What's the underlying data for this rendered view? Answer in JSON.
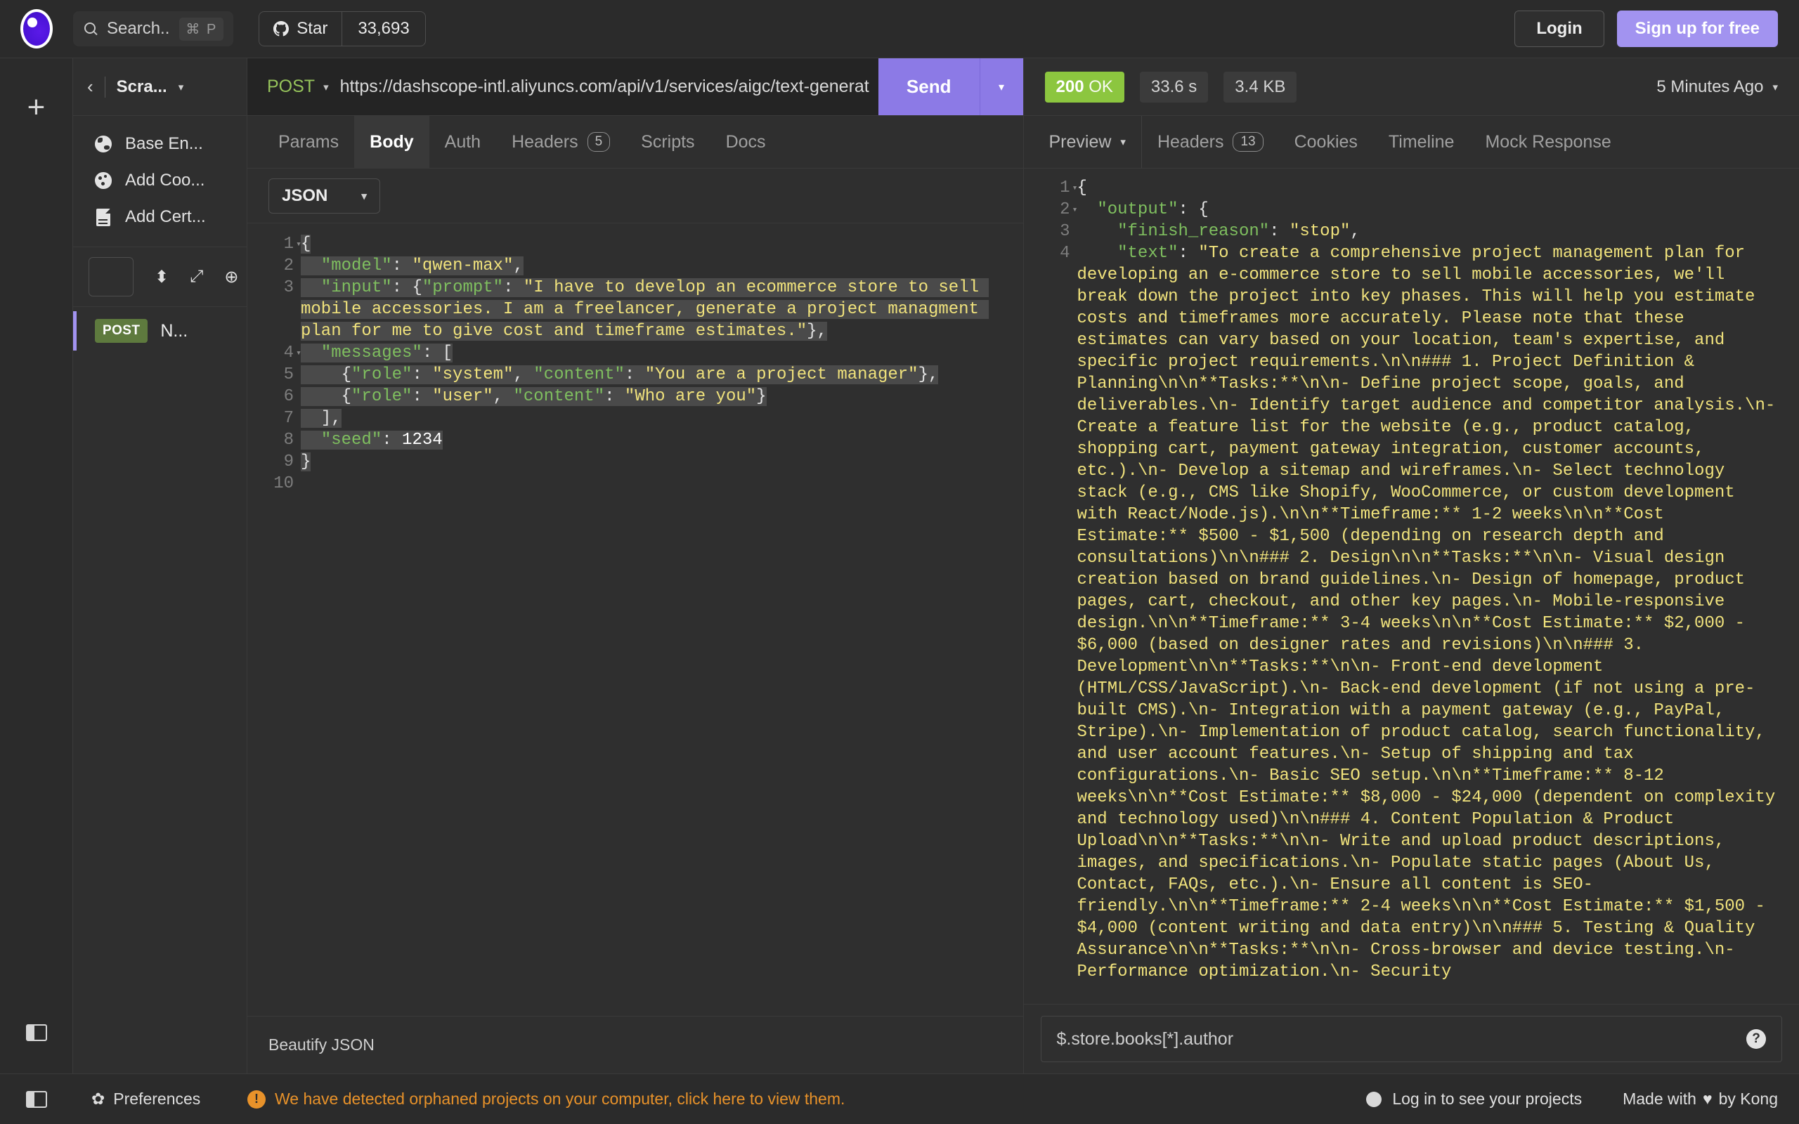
{
  "topbar": {
    "logo_icon": "insomnia-logo-icon",
    "search_placeholder": "Search..",
    "search_shortcut": "⌘ P",
    "star_label": "Star",
    "star_count": "33,693",
    "github_icon": "github-icon",
    "login_label": "Login",
    "signup_label": "Sign up for free"
  },
  "rail": {
    "add_icon": "plus-icon",
    "panel_toggle_icon": "sidebar-toggle-icon"
  },
  "sidebar": {
    "back_icon": "chevron-left-icon",
    "workspace_name": "Scra...",
    "workspace_caret": "▾",
    "actions": [
      {
        "label": "Base En...",
        "icon": "globe-icon"
      },
      {
        "label": "Add Coo...",
        "icon": "cookie-icon"
      },
      {
        "label": "Add Cert...",
        "icon": "certificate-icon"
      }
    ],
    "tools": {
      "filter_icon": "filter-box-icon",
      "sort_icon": "sort-updown-icon",
      "expand_icon": "expand-arrows-icon",
      "add_icon": "plus-circle-icon"
    },
    "requests": [
      {
        "method": "POST",
        "name": "N...",
        "active": true
      }
    ]
  },
  "request": {
    "method": "POST",
    "method_caret": "▾",
    "url": "https://dashscope-intl.aliyuncs.com/api/v1/services/aigc/text-generat",
    "send_label": "Send",
    "send_caret": "▾",
    "tabs": [
      {
        "label": "Params",
        "active": false
      },
      {
        "label": "Body",
        "active": true
      },
      {
        "label": "Auth",
        "active": false
      },
      {
        "label": "Headers",
        "active": false,
        "badge": "5"
      },
      {
        "label": "Scripts",
        "active": false
      },
      {
        "label": "Docs",
        "active": false
      }
    ],
    "body_type": "JSON",
    "body_type_caret": "▾",
    "beautify_label": "Beautify JSON",
    "editor": {
      "line_numbers": [
        "1",
        "2",
        "3",
        "4",
        "5",
        "6",
        "7",
        "8",
        "9",
        "10"
      ],
      "fold_lines": [
        "1",
        "4"
      ],
      "lines": [
        "{",
        "  \"model\": \"qwen-max\",",
        "  \"input\": {\"prompt\": \"I have to develop an ecommerce store to sell mobile accessories. I am a freelancer, generate a project managment plan for me to give cost and timeframe estimates.\"},",
        "  \"messages\": [",
        "    {\"role\": \"system\", \"content\": \"You are a project manager\"},",
        "    {\"role\": \"user\", \"content\": \"Who are you\"}",
        "  ],",
        "  \"seed\": 1234",
        "}",
        ""
      ]
    }
  },
  "response": {
    "status_code": "200",
    "status_text": "OK",
    "elapsed": "33.6 s",
    "size": "3.4 KB",
    "history_label": "5 Minutes Ago",
    "history_caret": "▾",
    "tabs": [
      {
        "label": "Preview",
        "caret": "▾",
        "active": true
      },
      {
        "label": "Headers",
        "badge": "13",
        "active": false
      },
      {
        "label": "Cookies",
        "active": false
      },
      {
        "label": "Timeline",
        "active": false
      },
      {
        "label": "Mock Response",
        "active": false
      }
    ],
    "filter_value": "$.store.books[*].author",
    "help_icon": "question-mark-icon",
    "editor": {
      "line_numbers": [
        "1",
        "2",
        "3",
        "4"
      ],
      "fold_lines": [
        "1",
        "2"
      ],
      "json_open": "{",
      "output_key": "\"output\"",
      "output_open": ": {",
      "finish_reason_key": "\"finish_reason\"",
      "finish_reason_value": "\"stop\",",
      "text_key": "\"text\"",
      "text_value": "\"To create a comprehensive project management plan for developing an e-commerce store to sell mobile accessories, we'll break down the project into key phases. This will help you estimate costs and timeframes more accurately. Please note that these estimates can vary based on your location, team's expertise, and specific project requirements.\\n\\n### 1. Project Definition & Planning\\n\\n**Tasks:**\\n\\n- Define project scope, goals, and deliverables.\\n- Identify target audience and competitor analysis.\\n- Create a feature list for the website (e.g., product catalog, shopping cart, payment gateway integration, customer accounts, etc.).\\n- Develop a sitemap and wireframes.\\n- Select technology stack (e.g., CMS like Shopify, WooCommerce, or custom development with React/Node.js).\\n\\n**Timeframe:** 1-2 weeks\\n\\n**Cost Estimate:** $500 - $1,500 (depending on research depth and consultations)\\n\\n### 2. Design\\n\\n**Tasks:**\\n\\n- Visual design creation based on brand guidelines.\\n- Design of homepage, product pages, cart, checkout, and other key pages.\\n- Mobile-responsive design.\\n\\n**Timeframe:** 3-4 weeks\\n\\n**Cost Estimate:** $2,000 - $6,000 (based on designer rates and revisions)\\n\\n### 3. Development\\n\\n**Tasks:**\\n\\n- Front-end development (HTML/CSS/JavaScript).\\n- Back-end development (if not using a pre-built CMS).\\n- Integration with a payment gateway (e.g., PayPal, Stripe).\\n- Implementation of product catalog, search functionality, and user account features.\\n- Setup of shipping and tax configurations.\\n- Basic SEO setup.\\n\\n**Timeframe:** 8-12 weeks\\n\\n**Cost Estimate:** $8,000 - $24,000 (dependent on complexity and technology used)\\n\\n### 4. Content Population & Product Upload\\n\\n**Tasks:**\\n\\n- Write and upload product descriptions, images, and specifications.\\n- Populate static pages (About Us, Contact, FAQs, etc.).\\n- Ensure all content is SEO-friendly.\\n\\n**Timeframe:** 2-4 weeks\\n\\n**Cost Estimate:** $1,500 - $4,000 (content writing and data entry)\\n\\n### 5. Testing & Quality Assurance\\n\\n**Tasks:**\\n\\n- Cross-browser and device testing.\\n- Performance optimization.\\n- Security"
    }
  },
  "statusbar": {
    "preferences_label": "Preferences",
    "gear_icon": "gear-icon",
    "warning_icon": "warning-icon",
    "warning_text": "We have detected orphaned projects on your computer, click here to view them.",
    "login_projects_label": "Log in to see your projects",
    "status_dot_icon": "status-dot-icon",
    "made_with_prefix": "Made with",
    "heart_icon": "heart-icon",
    "made_with_suffix": "by Kong"
  },
  "colors": {
    "accent": "#8c7ae6",
    "success": "#8cc63f",
    "warning": "#e8922a",
    "method_post": "#5e7a3e",
    "signup": "#a293f0"
  }
}
